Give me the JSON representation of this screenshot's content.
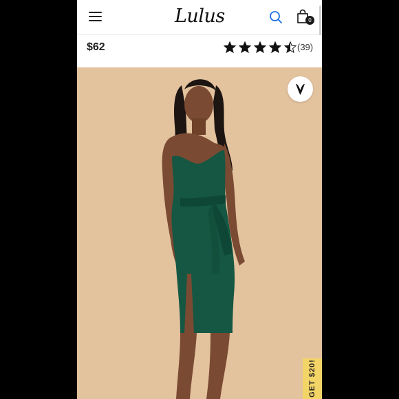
{
  "header": {
    "brand": "Lulus",
    "bag_count": "0"
  },
  "product": {
    "price": "$62",
    "rating": 4.5,
    "review_count": "(39)"
  },
  "promo": {
    "tab_text": "GET $20!"
  },
  "icons": {
    "menu": "hamburger-menu-icon",
    "search": "search-icon",
    "bag": "shopping-bag-icon",
    "wishlist": "heart-v-icon",
    "star": "star-icon"
  },
  "colors": {
    "accent": "#1a6fe0",
    "photo_background": "#e3c29e",
    "dress": "#155743",
    "promo": "#f3d466"
  }
}
